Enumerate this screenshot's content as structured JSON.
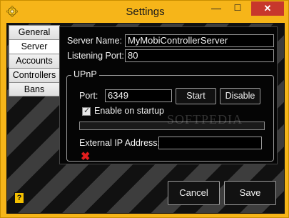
{
  "window": {
    "title": "Settings",
    "minimize_glyph": "—",
    "maximize_glyph": "☐",
    "close_glyph": "✕",
    "app_icon": "gear-icon"
  },
  "tabs": [
    {
      "label": "General",
      "active": false
    },
    {
      "label": "Server",
      "active": true
    },
    {
      "label": "Accounts",
      "active": false
    },
    {
      "label": "Controllers",
      "active": false
    },
    {
      "label": "Bans",
      "active": false
    }
  ],
  "server": {
    "server_name_label": "Server Name:",
    "server_name_value": "MyMobiControllerServer",
    "listening_port_label": "Listening Port:",
    "listening_port_value": "80"
  },
  "upnp": {
    "group_title": "UPnP",
    "port_label": "Port:",
    "port_value": "6349",
    "start_label": "Start",
    "disable_label": "Disable",
    "enable_on_startup_label": "Enable on startup",
    "enable_on_startup_checked": true,
    "external_ip_label": "External IP Address:",
    "external_ip_value": "",
    "status_icon": "red-x-icon"
  },
  "footer": {
    "help_label": "?",
    "cancel_label": "Cancel",
    "save_label": "Save"
  },
  "watermark": "SOFTPEDIA"
}
